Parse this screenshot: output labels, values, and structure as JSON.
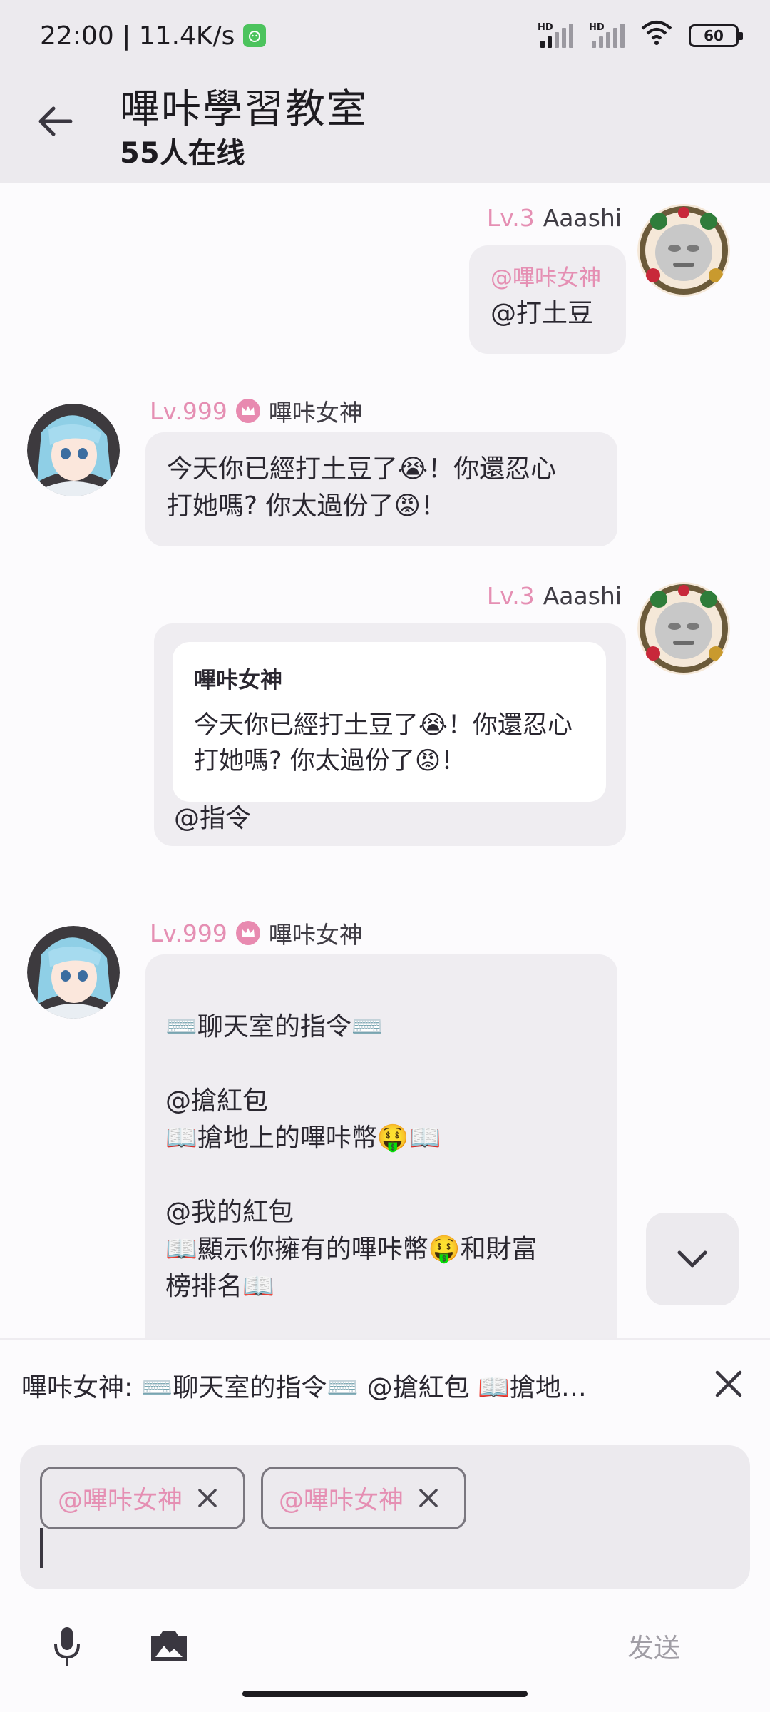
{
  "status_bar": {
    "time_speed": "22:00 | 11.4K/s",
    "signal1_label": "HD",
    "signal2_label": "HD",
    "battery": "60"
  },
  "header": {
    "title": "嗶咔學習教室",
    "subtitle": "55人在线"
  },
  "messages": [
    {
      "side": "right",
      "level": "Lv.3",
      "name": "Aaashi",
      "mention": "@嗶咔女神",
      "text": "@打土豆"
    },
    {
      "side": "left",
      "level": "Lv.999",
      "name": "嗶咔女神",
      "text": "今天你已經打土豆了😭！你還忍心\n打她嗎? 你太過份了😡！"
    },
    {
      "side": "right",
      "level": "Lv.3",
      "name": "Aaashi",
      "quote_name": "嗶咔女神",
      "quote_text": "今天你已經打土豆了😭！你還忍心\n打她嗎? 你太過份了😡！",
      "text": "@指令"
    },
    {
      "side": "left",
      "level": "Lv.999",
      "name": "嗶咔女神",
      "text": "  ⌨️聊天室的指令⌨️\n\n  @搶紅包\n  📖搶地上的嗶咔幣🤑📖\n\n  @我的紅包\n  📖顯示你擁有的嗶咔幣🤑和財富\n榜排名📖"
    }
  ],
  "reply_preview": {
    "text": "嗶咔女神:  ⌨️聊天室的指令⌨️  @搶紅包  📖搶地…"
  },
  "input": {
    "chips": [
      "@嗶咔女神",
      "@嗶咔女神"
    ]
  },
  "toolbar": {
    "send_label": "发送"
  },
  "icons": {
    "back": "arrow-left-icon",
    "scroll_down": "chevron-down-icon",
    "close": "close-icon",
    "mic": "mic-icon",
    "photo": "photo-icon",
    "crown": "crown-icon"
  },
  "colors": {
    "accent_pink": "#e58fb3",
    "bubble": "#efedf1",
    "bar": "#eceaee"
  }
}
